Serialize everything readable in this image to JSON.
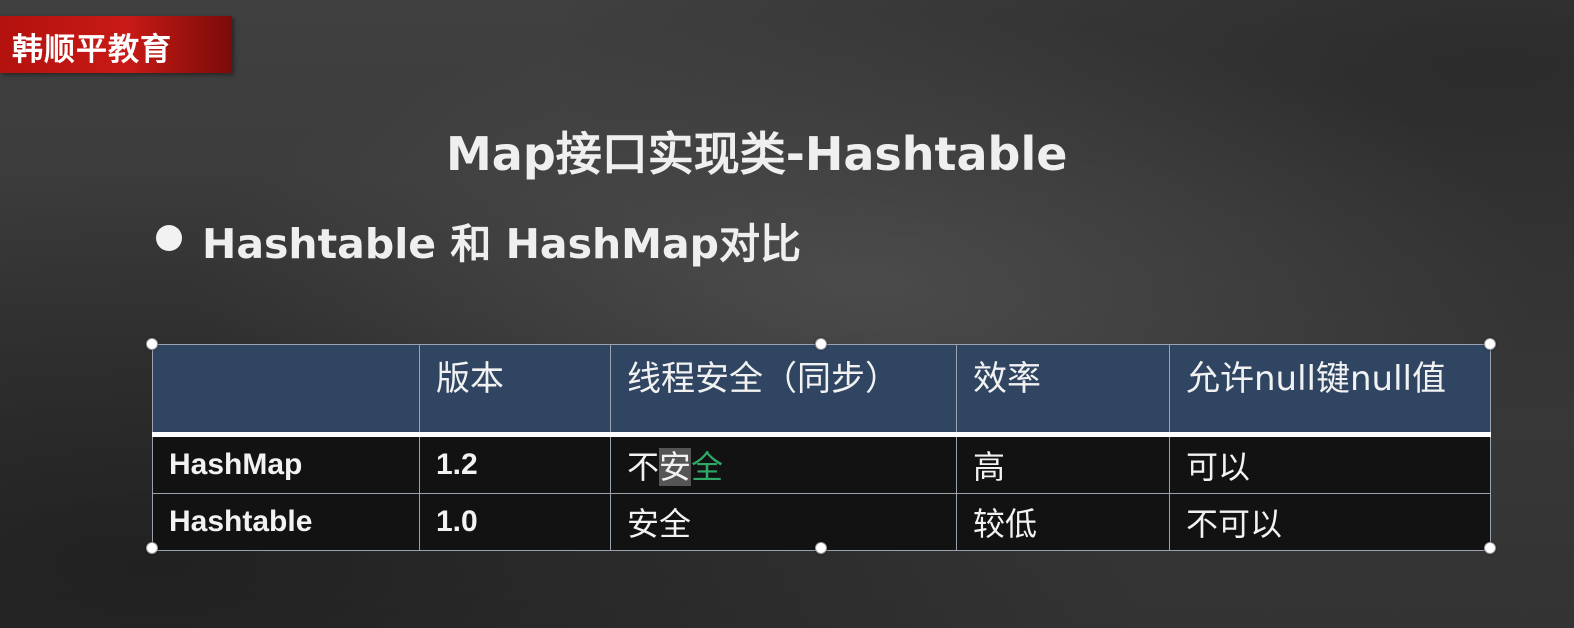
{
  "brand": {
    "logo_text": "韩顺平教育"
  },
  "slide": {
    "title": "Map接口实现类-Hashtable",
    "bullet_text": "Hashtable 和 HashMap对比"
  },
  "table": {
    "headers": [
      "",
      "版本",
      "线程安全（同步）",
      "效率",
      "允许null键null值"
    ],
    "rows": [
      {
        "name": "HashMap",
        "version": "1.2",
        "thread_safe_parts": [
          "不",
          "安",
          "全"
        ],
        "efficiency": "高",
        "allow_null": "可以"
      },
      {
        "name": "Hashtable",
        "version": "1.0",
        "thread_safe": "安全",
        "efficiency": "较低",
        "allow_null": "不可以"
      }
    ]
  },
  "colors": {
    "brand_red": "#c81a16",
    "header_blue": "#2f4562",
    "row_black": "#121212",
    "selection_highlight": "#555555",
    "text_green": "#2ea866"
  }
}
